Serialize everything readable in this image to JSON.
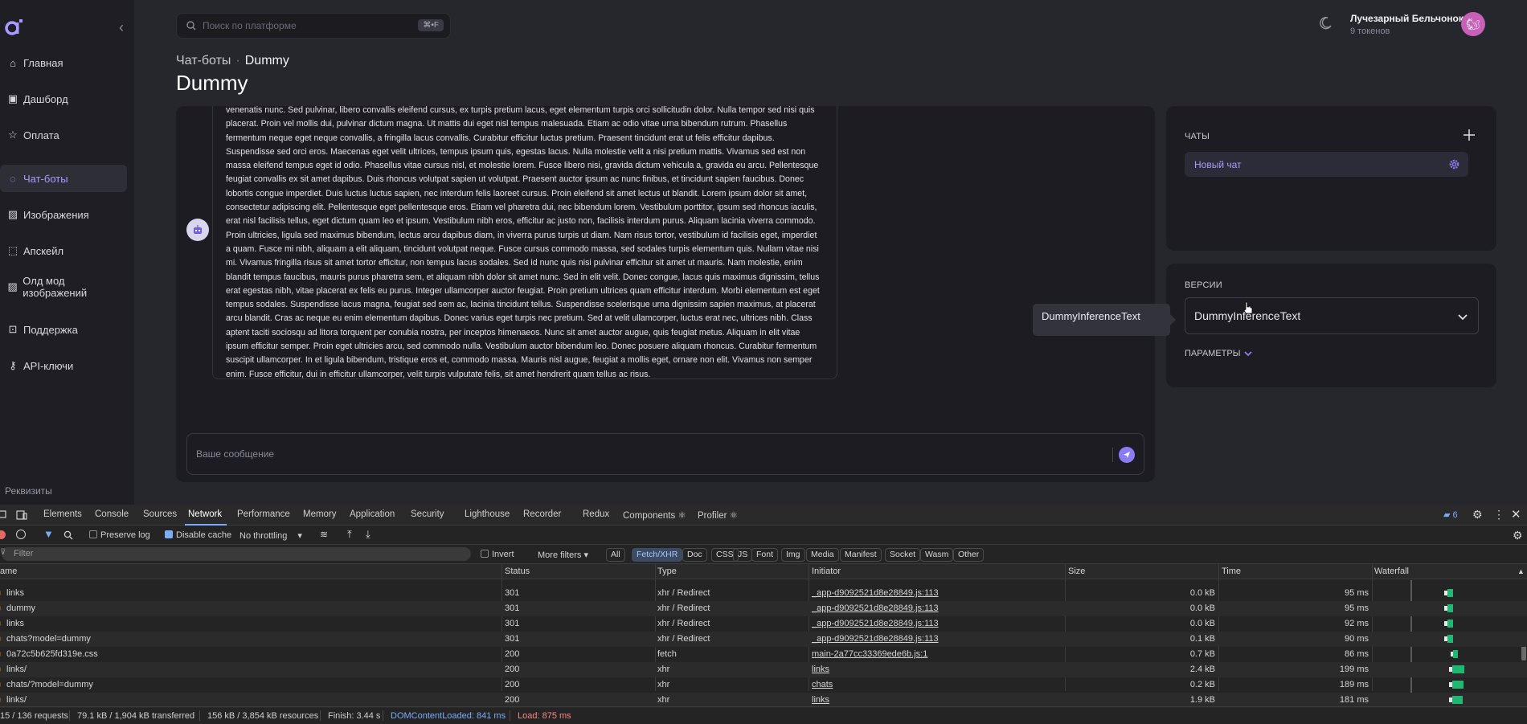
{
  "app": {
    "search_placeholder": "Поиск по платформе",
    "search_shortcut": "⌘•F",
    "user_name": "Лучезарный Бельчонок",
    "user_tokens": "9 токенов",
    "nav": [
      {
        "label": "Главная",
        "icon": "home-icon"
      },
      {
        "label": "Дашборд",
        "icon": "dashboard-icon"
      },
      {
        "label": "Оплата",
        "icon": "star-icon"
      },
      {
        "label": "Чат-боты",
        "icon": "chat-icon"
      },
      {
        "label": "Изображения",
        "icon": "image-icon"
      },
      {
        "label": "Апскейл",
        "icon": "upscale-icon"
      },
      {
        "label": "Олд мод изображений",
        "icon": "image-icon"
      },
      {
        "label": "Поддержка",
        "icon": "support-icon"
      },
      {
        "label": "API-ключи",
        "icon": "key-icon"
      }
    ],
    "requisites": "Реквизиты",
    "breadcrumb": {
      "parent": "Чат-боты",
      "separator": "·",
      "current": "Dummy"
    },
    "page_title": "Dummy",
    "message_text": "venenatis nunc. Sed pulvinar, libero convallis eleifend cursus, ex turpis pretium lacus, eget elementum turpis orci sollicitudin dolor. Nulla tempor sed nisi quis placerat. Proin vel mollis dui, pulvinar dictum magna. Ut mattis dui eget nisl tempus malesuada. Etiam ac odio vitae urna bibendum rutrum. Phasellus fermentum neque eget neque convallis, a fringilla lacus convallis. Curabitur efficitur luctus pretium. Praesent tincidunt erat ut felis efficitur dapibus. Suspendisse sed orci eros. Maecenas eget velit ultrices, tempus ipsum quis, egestas lacus. Nulla molestie velit a nisi pretium mattis. Vivamus sed est non massa eleifend tempus eget id odio. Phasellus vitae cursus nisl, et molestie lorem. Fusce libero nisi, gravida dictum vehicula a, gravida eu arcu. Pellentesque feugiat convallis ex sit amet dapibus. Duis rhoncus volutpat sapien ut volutpat. Praesent auctor ipsum ac nunc finibus, et tincidunt sapien faucibus. Donec lobortis congue imperdiet. Duis luctus luctus sapien, nec interdum felis laoreet cursus. Proin eleifend sit amet lectus ut blandit. Lorem ipsum dolor sit amet, consectetur adipiscing elit. Pellentesque eget pellentesque eros. Etiam vel pharetra dui, nec bibendum lorem. Vestibulum porttitor, ipsum sed rhoncus iaculis, erat nisl facilisis tellus, eget dictum quam leo et ipsum. Vestibulum nibh eros, efficitur ac justo non, facilisis interdum purus. Aliquam lacinia viverra commodo. Proin ultricies, ligula sed maximus bibendum, lectus arcu dapibus diam, in viverra purus turpis ut diam. Nam risus tortor, vestibulum id facilisis eget, imperdiet a quam. Fusce mi nibh, aliquam a elit aliquam, tincidunt volutpat neque. Fusce cursus commodo massa, sed sodales turpis elementum quis. Nullam vitae nisi mi. Vivamus fringilla risus sit amet tortor efficitur, non tempus lacus sodales. Sed id nunc quis nisi pulvinar efficitur sit amet ut mauris. Nam molestie, enim blandit tempus faucibus, mauris purus pharetra sem, et aliquam nibh dolor sit amet nunc. Sed in elit velit. Donec congue, lacus quis maximus dignissim, tellus erat egestas nibh, vitae placerat ex felis eu purus. Integer ullamcorper auctor feugiat. Proin pretium ultrices quam efficitur interdum. Morbi elementum est eget tempus sodales. Suspendisse lacus magna, feugiat sed sem ac, lacinia tincidunt tellus. Suspendisse scelerisque urna dignissim sapien maximus, at placerat arcu blandit. Cras ac neque eu enim elementum dapibus. Donec varius eget turpis nec pretium. Sed at velit ullamcorper, luctus erat nec, ultrices nibh. Class aptent taciti sociosqu ad litora torquent per conubia nostra, per inceptos himenaeos. Nunc sit amet auctor augue, quis feugiat metus. Aliquam in elit vitae ipsum efficitur semper. Proin eget ultricies arcu, sed commodo nulla. Vestibulum auctor bibendum leo. Donec posuere aliquam rhoncus. Curabitur fermentum suscipit ullamcorper. In et ligula bibendum, tristique eros et, commodo massa. Mauris nisl augue, feugiat a mollis eget, ornare non elit. Vivamus non semper enim. Fusce efficitur, dui in efficitur ullamcorper, velit turpis vulputate felis, sit amet hendrerit quam tellus ac risus.",
    "input_placeholder": "Ваше сообщение",
    "chats_label": "ЧАТЫ",
    "chat_item": "Новый чат",
    "versions_label": "ВЕРСИИ",
    "version_selected": "DummyInferenceText",
    "params_label": "ПАРАМЕТРЫ",
    "tooltip": "DummyInferenceText",
    "accent": "#8b7cf6"
  },
  "devtools": {
    "tabs": [
      "Elements",
      "Console",
      "Sources",
      "Network",
      "Performance",
      "Memory",
      "Application",
      "Security",
      "Lighthouse",
      "Recorder",
      "Redux",
      "Components ⚛",
      "Profiler ⚛"
    ],
    "issues_count": "6",
    "toolbar": {
      "preserve_log": "Preserve log",
      "disable_cache": "Disable cache",
      "throttling": "No throttling"
    },
    "filter_placeholder": "Filter",
    "invert": "Invert",
    "more_filters": "More filters",
    "type_filters": [
      "All",
      "Fetch/XHR",
      "Doc",
      "CSS",
      "JS",
      "Font",
      "Img",
      "Media",
      "Manifest",
      "Socket",
      "Wasm",
      "Other"
    ],
    "columns": [
      "ame",
      "Status",
      "Type",
      "Initiator",
      "Size",
      "Time",
      "Waterfall"
    ],
    "rows": [
      {
        "name": "links",
        "status": "301",
        "type": "xhr / Redirect",
        "initiator": "_app-d9092521d8e28849.js:113",
        "size": "0.0 kB",
        "time": "95 ms"
      },
      {
        "name": "dummy",
        "status": "301",
        "type": "xhr / Redirect",
        "initiator": "_app-d9092521d8e28849.js:113",
        "size": "0.0 kB",
        "time": "95 ms"
      },
      {
        "name": "links",
        "status": "301",
        "type": "xhr / Redirect",
        "initiator": "_app-d9092521d8e28849.js:113",
        "size": "0.0 kB",
        "time": "92 ms"
      },
      {
        "name": "chats?model=dummy",
        "status": "301",
        "type": "xhr / Redirect",
        "initiator": "_app-d9092521d8e28849.js:113",
        "size": "0.1 kB",
        "time": "90 ms"
      },
      {
        "name": "0a72c5b625fd319e.css",
        "status": "200",
        "type": "fetch",
        "initiator": "main-2a77cc33369ede6b.js:1",
        "size": "0.7 kB",
        "time": "86 ms"
      },
      {
        "name": "links/",
        "status": "200",
        "type": "xhr",
        "initiator": "links",
        "size": "2.4 kB",
        "time": "199 ms"
      },
      {
        "name": "chats/?model=dummy",
        "status": "200",
        "type": "xhr",
        "initiator": "chats",
        "size": "0.2 kB",
        "time": "189 ms"
      },
      {
        "name": "links/",
        "status": "200",
        "type": "xhr",
        "initiator": "links",
        "size": "1.9 kB",
        "time": "181 ms"
      }
    ],
    "status": {
      "requests": "15 / 136 requests",
      "transferred": "79.1 kB / 1,904 kB transferred",
      "resources": "156 kB / 3,854 kB resources",
      "finish": "Finish: 3.44 s",
      "dcl": "DOMContentLoaded: 841 ms",
      "load": "Load: 875 ms"
    }
  }
}
